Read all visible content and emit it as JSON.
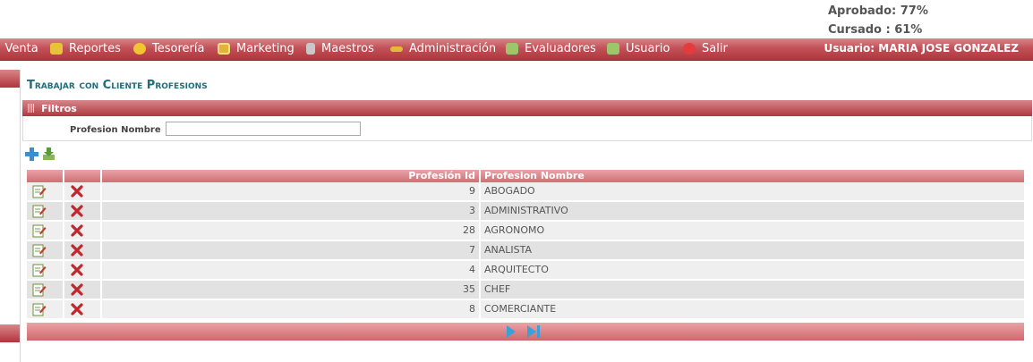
{
  "stats": {
    "approved": "Aprobado: 77%",
    "taken": "Cursado : 61%"
  },
  "menu": [
    {
      "label": ": Venta",
      "icon": "partial"
    },
    {
      "label": "Reportes",
      "icon": "reports-icon",
      "color": "#e8c23a"
    },
    {
      "label": "Tesorería",
      "icon": "coin-icon",
      "color": "#f3c431"
    },
    {
      "label": "Marketing",
      "icon": "monitor-icon",
      "color": "#e0b33c"
    },
    {
      "label": "Maestros",
      "icon": "database-icon",
      "color": "#c8c8c8"
    },
    {
      "label": "Administración",
      "icon": "key-icon",
      "color": "#e6b83a"
    },
    {
      "label": "Evaluadores",
      "icon": "group-icon",
      "color": "#9fc56b"
    },
    {
      "label": "Usuario",
      "icon": "user-icon",
      "color": "#9fc56b"
    },
    {
      "label": "Salir",
      "icon": "exit-icon",
      "color": "#e23c3c"
    }
  ],
  "user": {
    "prefix": "Usuario:",
    "name": "MARIA JOSE GONZALEZ"
  },
  "page": {
    "title": "Trabajar con Cliente Profesions"
  },
  "filters": {
    "header": "Filtros",
    "label": "Profesion Nombre",
    "value": ""
  },
  "grid": {
    "columns": [
      "",
      "",
      "Profesión Id",
      "Profesion Nombre"
    ],
    "rows": [
      {
        "id": "9",
        "name": "ABOGADO"
      },
      {
        "id": "3",
        "name": "ADMINISTRATIVO"
      },
      {
        "id": "28",
        "name": "AGRONOMO"
      },
      {
        "id": "7",
        "name": "ANALISTA"
      },
      {
        "id": "4",
        "name": "ARQUITECTO"
      },
      {
        "id": "35",
        "name": "CHEF"
      },
      {
        "id": "8",
        "name": "COMERCIANTE"
      }
    ]
  },
  "colors": {
    "accent": "#b0353c",
    "title": "#1f6e7a",
    "pager_icon": "#3aa0d8"
  }
}
